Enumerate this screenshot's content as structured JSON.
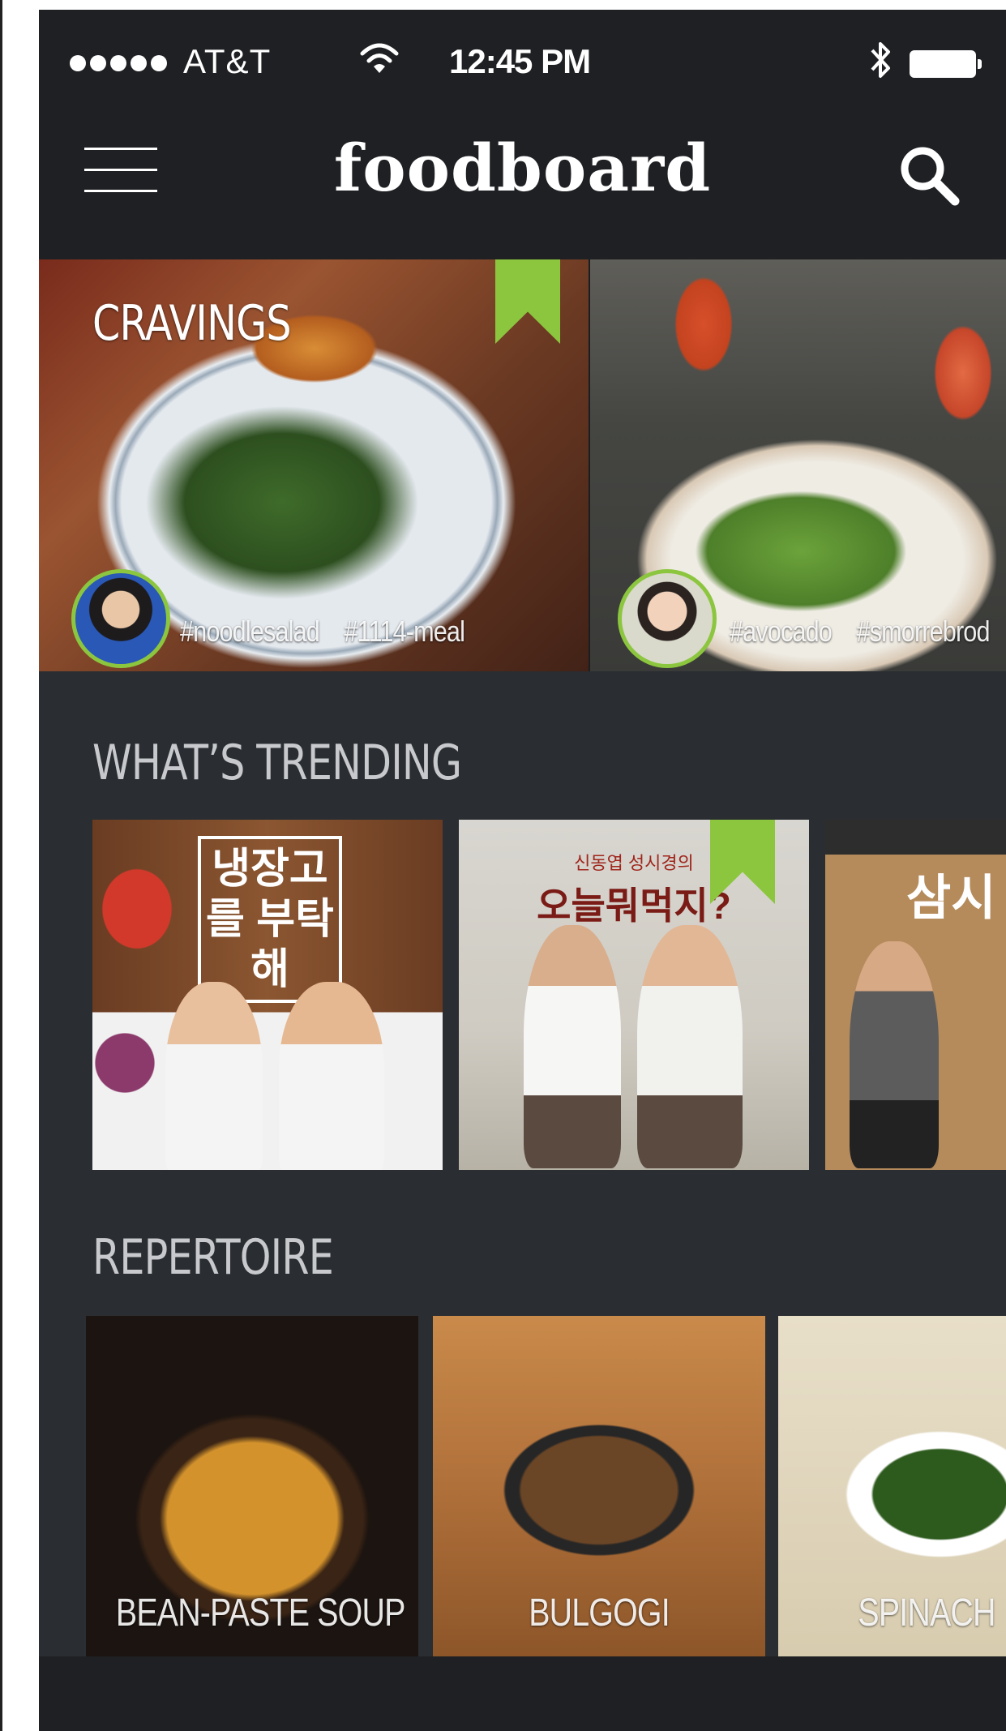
{
  "status_bar": {
    "carrier": "AT&T",
    "time": "12:45 PM"
  },
  "header": {
    "title": "foodboard"
  },
  "cravings": {
    "title": "CRAVINGS",
    "cards": [
      {
        "tags": [
          "#noodlesalad",
          "#1114-meal"
        ]
      },
      {
        "tags": [
          "#avocado",
          "#smorrebrod"
        ]
      }
    ]
  },
  "trending": {
    "title": "WHAT’S TRENDING",
    "cards": [
      {
        "title": "냉장고 를 부탁해"
      },
      {
        "subtitle": "신동엽 성시경의",
        "title": "오늘뭐먹지?"
      },
      {
        "title": "삼시"
      }
    ]
  },
  "repertoire": {
    "title": "REPERTOIRE",
    "items": [
      {
        "label": "BEAN-PASTE SOUP"
      },
      {
        "label": "BULGOGI"
      },
      {
        "label": "SPINACH"
      }
    ]
  },
  "colors": {
    "accent": "#8cc63f",
    "background": "#2a2d31",
    "header": "#1e2023"
  }
}
